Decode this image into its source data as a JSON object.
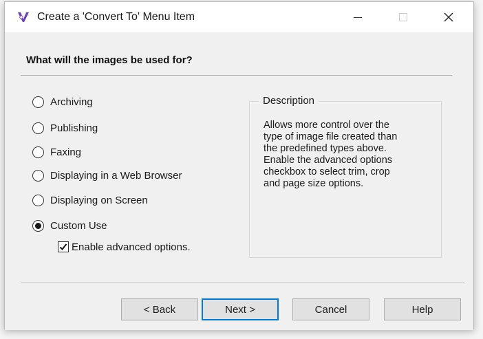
{
  "window": {
    "title": "Create a 'Convert To' Menu Item",
    "icon": "app-logo-icon",
    "controls": {
      "minimize": "minimize-icon",
      "maximize": "maximize-icon",
      "close": "close-icon"
    }
  },
  "main": {
    "heading": "What will the images be used for?",
    "options": [
      {
        "label": "Archiving",
        "selected": false
      },
      {
        "label": "Publishing",
        "selected": false
      },
      {
        "label": "Faxing",
        "selected": false
      },
      {
        "label": "Displaying in a Web Browser",
        "selected": false
      },
      {
        "label": "Displaying on Screen",
        "selected": false
      },
      {
        "label": "Custom Use",
        "selected": true
      }
    ],
    "advanced": {
      "label": "Enable advanced options.",
      "checked": true
    },
    "description": {
      "title": "Description",
      "lines": [
        "Allows more control over the",
        "type of image file created than",
        "the predefined types above.",
        "Enable the advanced options",
        "checkbox to select trim, crop",
        "and page size options."
      ]
    }
  },
  "buttons": {
    "back": "< Back",
    "next": "Next >",
    "cancel": "Cancel",
    "help": "Help"
  },
  "colors": {
    "dialog_bg": "#f0f0f0",
    "titlebar_bg": "#ffffff",
    "default_button_border": "#0078d7",
    "button_bg": "#e1e1e1"
  }
}
